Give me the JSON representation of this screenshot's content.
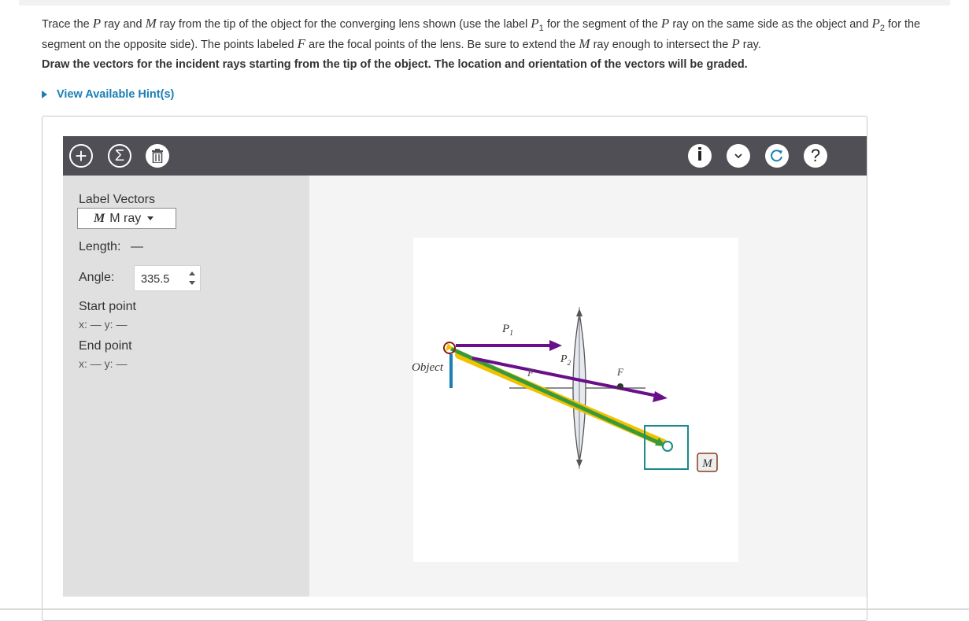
{
  "question": {
    "part1": "Trace the ",
    "p": "P",
    "part2": " ray and ",
    "m": "M",
    "part3": " ray from the tip of the object for the converging lens shown (use the label ",
    "p1_base": "P",
    "p1_sub": "1",
    "part4": " for the segment of the ",
    "part5": " ray on the same side as the object and ",
    "p2_base": "P",
    "p2_sub": "2",
    "part6": " for the segment on the opposite side). The points labeled ",
    "f": "F",
    "part7": " are the focal points of the lens. Be sure to extend the ",
    "part8": " ray enough to intersect the ",
    "part9": " ray."
  },
  "instruction": "Draw the vectors for the incident rays starting from the tip of the object. The location and orientation of the vectors will be graded.",
  "hint_label": "View Available Hint(s)",
  "toolbar": {
    "add": "+",
    "sum": "Σ",
    "info": "i",
    "help": "?"
  },
  "sidebar": {
    "label_vectors": "Label Vectors",
    "selected_label_symbol": "M",
    "selected_label_text": "M ray",
    "length_label": "Length:",
    "length_value": "—",
    "angle_label": "Angle:",
    "angle_value": "335.5",
    "start_label": "Start point",
    "start_xy": "x: — y: —",
    "end_label": "End point",
    "end_xy": "x: — y: —"
  },
  "diagram": {
    "object_label": "Object",
    "p1_base": "P",
    "p1_sub": "1",
    "p2_base": "P",
    "p2_sub": "2",
    "focal_left": "F",
    "focal_right": "F",
    "m_tag": "M"
  },
  "colors": {
    "toolbar": "#4f4f55",
    "hint": "#1a7fb5",
    "p_ray": "#6a0f8a",
    "m_ray": "#3a9a3a",
    "m_highlight": "#f2c200",
    "handle": "#1a8a8a",
    "object": "#1a7fb5",
    "tag_border": "#8b3a1a"
  }
}
